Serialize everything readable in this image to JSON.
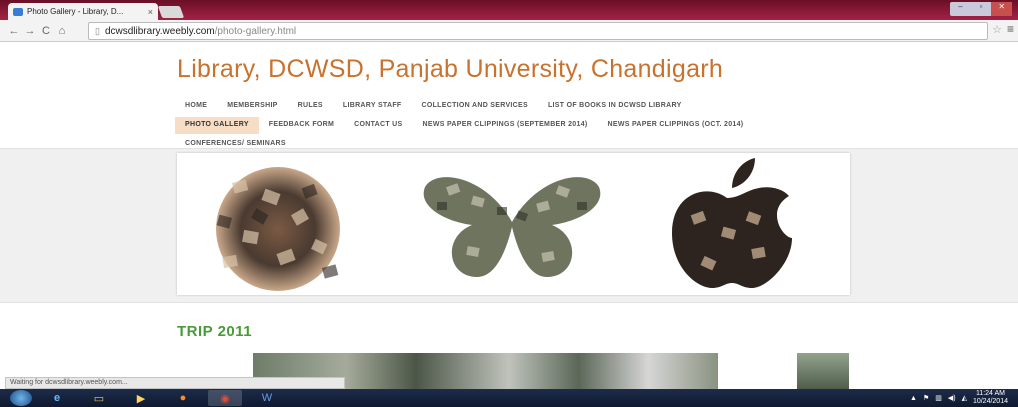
{
  "browser": {
    "tab_title": "Photo Gallery - Library, D...",
    "tab_close": "×",
    "url_host": "dcwsdlibrary.weebly.com",
    "url_path": "/photo-gallery.html"
  },
  "site": {
    "title": "Library, DCWSD, Panjab University, Chandigarh",
    "nav_row1": [
      "HOME",
      "MEMBERSHIP",
      "RULES",
      "LIBRARY STAFF",
      "COLLECTION AND SERVICES",
      "LIST OF BOOKS IN DCWSD LIBRARY"
    ],
    "nav_row2": [
      "PHOTO GALLERY",
      "FEEDBACK FORM",
      "CONTACT US",
      "NEWS PAPER CLIPPINGS (SEPTEMBER 2014)",
      "NEWS PAPER CLIPPINGS (OCT. 2014)"
    ],
    "nav_row3": [
      "CONFERENCES/ SEMINARS"
    ],
    "section_heading": "TRIP 2011"
  },
  "status_bar": {
    "text": "Waiting for dcwsdlibrary.weebly.com..."
  },
  "taskbar": {
    "clock_time": "11:24 AM",
    "clock_date": "10/24/2014"
  },
  "colors": {
    "title": "#c8722e",
    "section": "#4a9a37",
    "active_nav": "#f7dcc6"
  }
}
